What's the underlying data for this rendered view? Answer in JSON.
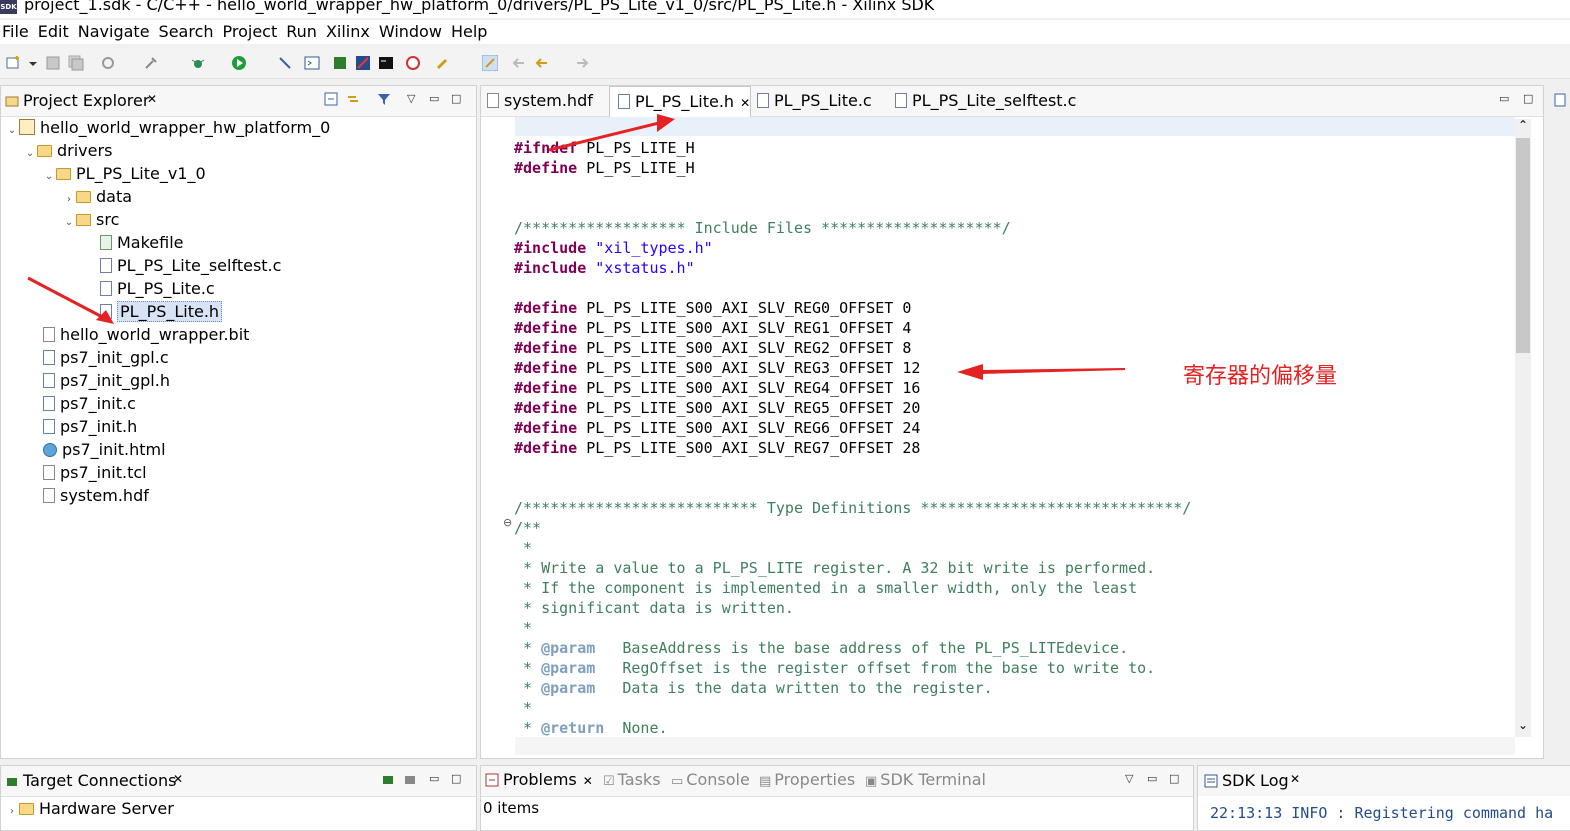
{
  "window": {
    "title": "project_1.sdk - C/C++ - hello_world_wrapper_hw_platform_0/drivers/PL_PS_Lite_v1_0/src/PL_PS_Lite.h - Xilinx SDK",
    "logo": "SDK"
  },
  "menu": [
    "File",
    "Edit",
    "Navigate",
    "Search",
    "Project",
    "Run",
    "Xilinx",
    "Window",
    "Help"
  ],
  "project_explorer": {
    "title": "Project Explorer",
    "items": [
      {
        "label": "hello_world_wrapper_hw_platform_0",
        "icon": "project-icon",
        "depth": 0,
        "expanded": true
      },
      {
        "label": "drivers",
        "icon": "folder-icon",
        "depth": 1,
        "expanded": true
      },
      {
        "label": "PL_PS_Lite_v1_0",
        "icon": "folder-icon",
        "depth": 2,
        "expanded": true
      },
      {
        "label": "data",
        "icon": "folder-icon",
        "depth": 3,
        "expanded": false
      },
      {
        "label": "src",
        "icon": "folder-icon",
        "depth": 3,
        "expanded": true
      },
      {
        "label": "Makefile",
        "icon": "makefile-icon",
        "depth": 4
      },
      {
        "label": "PL_PS_Lite_selftest.c",
        "icon": "c-file-icon",
        "depth": 4
      },
      {
        "label": "PL_PS_Lite.c",
        "icon": "c-file-icon",
        "depth": 4
      },
      {
        "label": "PL_PS_Lite.h",
        "icon": "h-file-icon",
        "depth": 4,
        "selected": true
      },
      {
        "label": "hello_world_wrapper.bit",
        "icon": "file-icon",
        "depth": 1
      },
      {
        "label": "ps7_init_gpl.c",
        "icon": "c-file-icon",
        "depth": 1
      },
      {
        "label": "ps7_init_gpl.h",
        "icon": "h-file-icon",
        "depth": 1
      },
      {
        "label": "ps7_init.c",
        "icon": "c-file-icon",
        "depth": 1
      },
      {
        "label": "ps7_init.h",
        "icon": "h-file-icon",
        "depth": 1
      },
      {
        "label": "ps7_init.html",
        "icon": "html-icon",
        "depth": 1
      },
      {
        "label": "ps7_init.tcl",
        "icon": "file-icon",
        "depth": 1
      },
      {
        "label": "system.hdf",
        "icon": "hdf-icon",
        "depth": 1
      }
    ]
  },
  "editor": {
    "tabs": [
      {
        "label": "system.hdf",
        "active": false
      },
      {
        "label": "PL_PS_Lite.h",
        "active": true
      },
      {
        "label": "PL_PS_Lite.c",
        "active": false
      },
      {
        "label": "PL_PS_Lite_selftest.c",
        "active": false
      }
    ],
    "code_lines": [
      "#ifndef PL_PS_LITE_H",
      "#define PL_PS_LITE_H",
      "",
      "",
      "/****************** Include Files ********************/",
      "#include \"xil_types.h\"",
      "#include \"xstatus.h\"",
      "",
      "#define PL_PS_LITE_S00_AXI_SLV_REG0_OFFSET 0",
      "#define PL_PS_LITE_S00_AXI_SLV_REG1_OFFSET 4",
      "#define PL_PS_LITE_S00_AXI_SLV_REG2_OFFSET 8",
      "#define PL_PS_LITE_S00_AXI_SLV_REG3_OFFSET 12",
      "#define PL_PS_LITE_S00_AXI_SLV_REG4_OFFSET 16",
      "#define PL_PS_LITE_S00_AXI_SLV_REG5_OFFSET 20",
      "#define PL_PS_LITE_S00_AXI_SLV_REG6_OFFSET 24",
      "#define PL_PS_LITE_S00_AXI_SLV_REG7_OFFSET 28",
      "",
      "",
      "/************************** Type Definitions *****************************/",
      "/**",
      " *",
      " * Write a value to a PL_PS_LITE register. A 32 bit write is performed.",
      " * If the component is implemented in a smaller width, only the least",
      " * significant data is written.",
      " *",
      " * @param   BaseAddress is the base address of the PL_PS_LITEdevice.",
      " * @param   RegOffset is the register offset from the base to write to.",
      " * @param   Data is the data written to the register.",
      " *",
      " * @return  None."
    ],
    "annotation": "寄存器的偏移量"
  },
  "target_connections": {
    "title": "Target Connections",
    "items": [
      "Hardware Server"
    ]
  },
  "bottom_tabs": [
    {
      "label": "Problems",
      "active": true
    },
    {
      "label": "Tasks",
      "active": false
    },
    {
      "label": "Console",
      "active": false
    },
    {
      "label": "Properties",
      "active": false
    },
    {
      "label": "SDK Terminal",
      "active": false
    }
  ],
  "problems": {
    "count": "0 items"
  },
  "sdk_log": {
    "title": "SDK Log",
    "line": "22:13:13 INFO  : Registering command ha"
  },
  "colors": {
    "keyword": "#7f0055",
    "string": "#2a00ff",
    "comment": "#3f7f5f",
    "annotation": "#e52222"
  }
}
